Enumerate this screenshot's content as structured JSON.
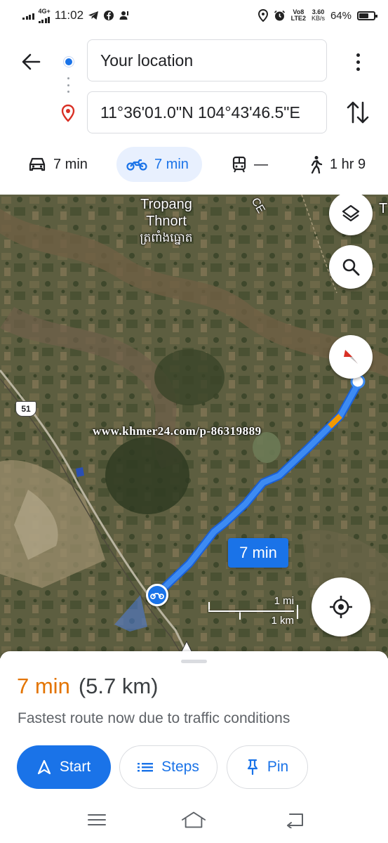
{
  "status_bar": {
    "network": "4G+",
    "time": "11:02",
    "volte": "Vo8",
    "lte": "LTE2",
    "speed": "3.60",
    "speed_unit": "KB/s",
    "battery": "64%",
    "battery_level": 0.64
  },
  "directions": {
    "origin": "Your location",
    "destination": "11°36'01.0\"N 104°43'46.5\"E"
  },
  "modes": [
    {
      "name": "car",
      "label": "7 min",
      "selected": false
    },
    {
      "name": "motorcycle",
      "label": "7 min",
      "selected": true
    },
    {
      "name": "transit",
      "label": "—",
      "selected": false
    },
    {
      "name": "walk",
      "label": "1 hr 9",
      "selected": false
    }
  ],
  "map": {
    "place_label_line1": "Tropang",
    "place_label_line2": "Thnort",
    "place_label_khmer": "ត្រពាំងធ្នោត",
    "edge_label": "T",
    "edge_label_2": "CE",
    "road_number": "51",
    "watermark": "www.khmer24.com/p-86319889",
    "eta_chip": "7 min",
    "scale_mi": "1 mi",
    "scale_km": "1 km"
  },
  "sheet": {
    "duration": "7 min",
    "distance": "(5.7 km)",
    "subtitle": "Fastest route now due to traffic conditions",
    "start_label": "Start",
    "steps_label": "Steps",
    "pin_label": "Pin"
  },
  "colors": {
    "accent": "#1a73e8",
    "duration": "#e37400",
    "route": "#3d8bf2",
    "traffic_slow": "#f29900",
    "compass_red": "#d93025"
  },
  "icons": [
    "back-arrow-icon",
    "origin-dot-icon",
    "destination-pin-icon",
    "more-vert-icon",
    "swap-icon",
    "car-icon",
    "motorcycle-icon",
    "transit-icon",
    "walk-icon",
    "layers-icon",
    "search-icon",
    "compass-icon",
    "my-location-icon",
    "navigation-arrow-icon",
    "list-icon",
    "pin-icon",
    "menu-icon",
    "home-icon",
    "back-icon"
  ]
}
